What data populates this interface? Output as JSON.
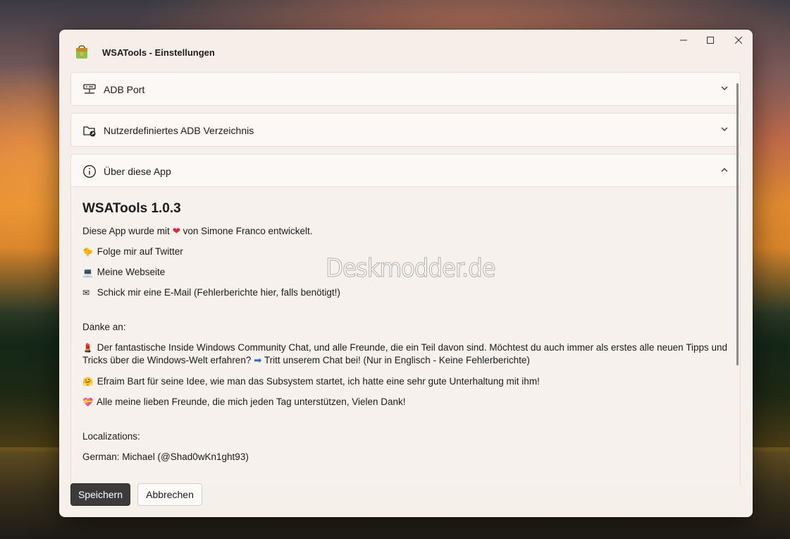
{
  "window": {
    "title": "WSATools - Einstellungen",
    "controls": {
      "minimize": "–",
      "maximize": "☐",
      "close": "✕"
    }
  },
  "sections": {
    "adb_port": {
      "label": "ADB Port",
      "icon": "network-port-icon",
      "expanded": false
    },
    "adb_dir": {
      "label": "Nutzerdefiniertes ADB Verzeichnis",
      "icon": "folder-link-icon",
      "expanded": false
    },
    "about": {
      "label": "Über diese App",
      "icon": "info-icon",
      "expanded": true
    }
  },
  "about": {
    "title": "WSATools 1.0.3",
    "made_prefix": "Diese App wurde mit",
    "made_heart": "❤",
    "made_suffix": "von Simone Franco entwickelt.",
    "twitter_emoji": "🐤",
    "twitter": "Folge mir auf Twitter",
    "website_emoji": "💻",
    "website": "Meine Webseite",
    "email_emoji": "✉",
    "email": "Schick mir eine E-Mail (Fehlerberichte hier, falls benötigt!)",
    "thanks_heading": "Danke an:",
    "thanks1_emoji": "💄",
    "thanks1": "Der fantastische Inside Windows Community Chat, und alle Freunde, die ein Teil davon sind. Möchtest du auch immer als erstes alle neuen Tipps und Tricks über die Windows-Welt erfahren?",
    "thanks1_arrow": "➡",
    "thanks1_link": "Tritt unserem Chat bei! (Nur in Englisch - Keine Fehlerberichte)",
    "thanks2_emoji": "🤗",
    "thanks2": "Efraim Bart für seine Idee, wie man das Subsystem startet, ich hatte eine sehr gute Unterhaltung mit ihm!",
    "thanks3_emoji": "💝",
    "thanks3": "Alle meine lieben Freunde, die mich jeden Tag unterstützen, Vielen Dank!",
    "localizations_heading": "Localizations:",
    "german": "German: Michael (@Shad0wKn1ght93)"
  },
  "footer": {
    "save": "Speichern",
    "cancel": "Abbrechen"
  },
  "watermark": "Deskmodder.de",
  "colors": {
    "accent_dark": "#3b3b3b",
    "heart": "#e0243a",
    "window_bg": "#f6efea"
  }
}
